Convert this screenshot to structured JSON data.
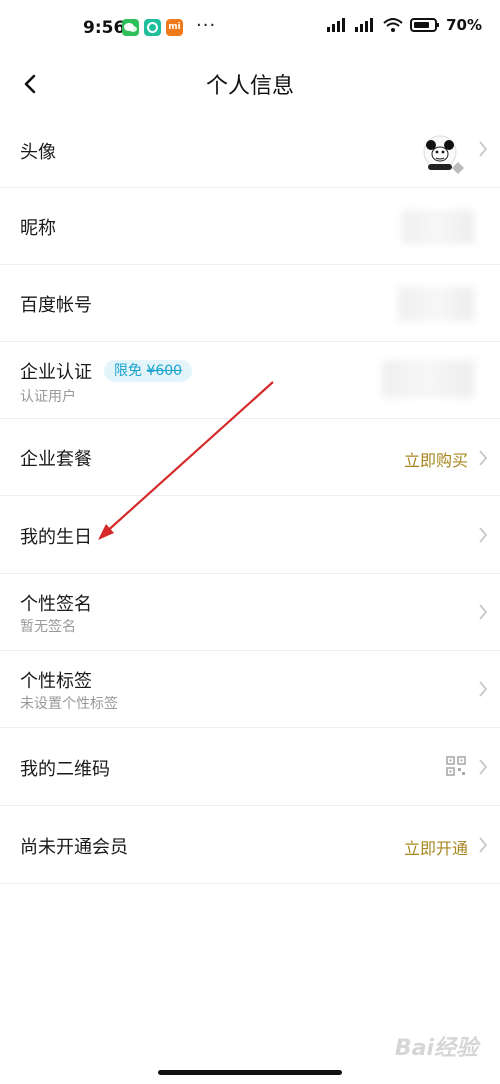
{
  "status_bar": {
    "time": "9:56",
    "app_icons": [
      "wechat-icon",
      "shield-icon",
      "mi-icon"
    ],
    "mi_label": "mi",
    "more": "···",
    "battery": "70%"
  },
  "nav": {
    "title": "个人信息"
  },
  "rows": {
    "avatar": {
      "title": "头像"
    },
    "nickname": {
      "title": "昵称"
    },
    "baidu_account": {
      "title": "百度帐号"
    },
    "enterprise_cert": {
      "title": "企业认证",
      "subtitle": "认证用户",
      "badge_prefix": "限免",
      "badge_price": "¥600"
    },
    "enterprise_package": {
      "title": "企业套餐",
      "action": "立即购买"
    },
    "birthday": {
      "title": "我的生日"
    },
    "signature": {
      "title": "个性签名",
      "subtitle": "暂无签名"
    },
    "tags": {
      "title": "个性标签",
      "subtitle": "未设置个性标签"
    },
    "qrcode": {
      "title": "我的二维码"
    },
    "membership": {
      "title": "尚未开通会员",
      "action": "立即开通"
    }
  },
  "colors": {
    "gold": "#a8861f",
    "badge_blue": "#1aa3cf",
    "annotation_red": "#d42a2a"
  },
  "watermark": "Bai经验"
}
